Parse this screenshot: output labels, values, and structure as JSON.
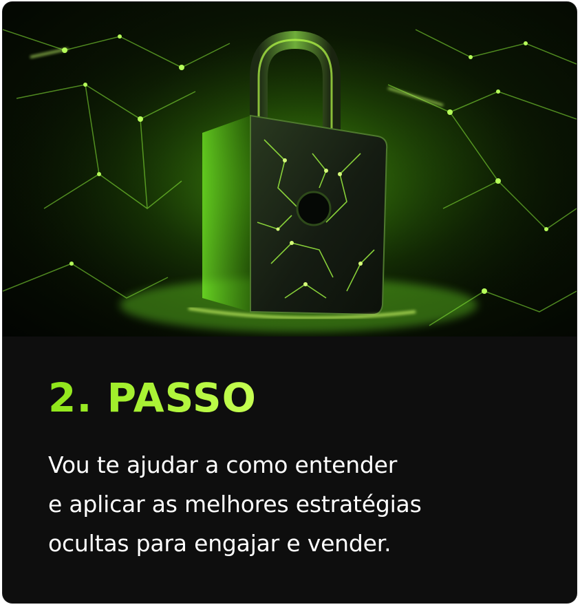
{
  "hero": {
    "icon": "padlock-icon",
    "accent_color": "#a3f03a"
  },
  "step": {
    "title": "2. PASSO",
    "description_lines": [
      "Vou te ajudar a como entender",
      "e aplicar as melhores estratégias",
      "ocultas para engajar e vender."
    ]
  },
  "colors": {
    "background": "#0e0e0e",
    "title_accent": "#a8f22a",
    "text": "#ffffff"
  }
}
